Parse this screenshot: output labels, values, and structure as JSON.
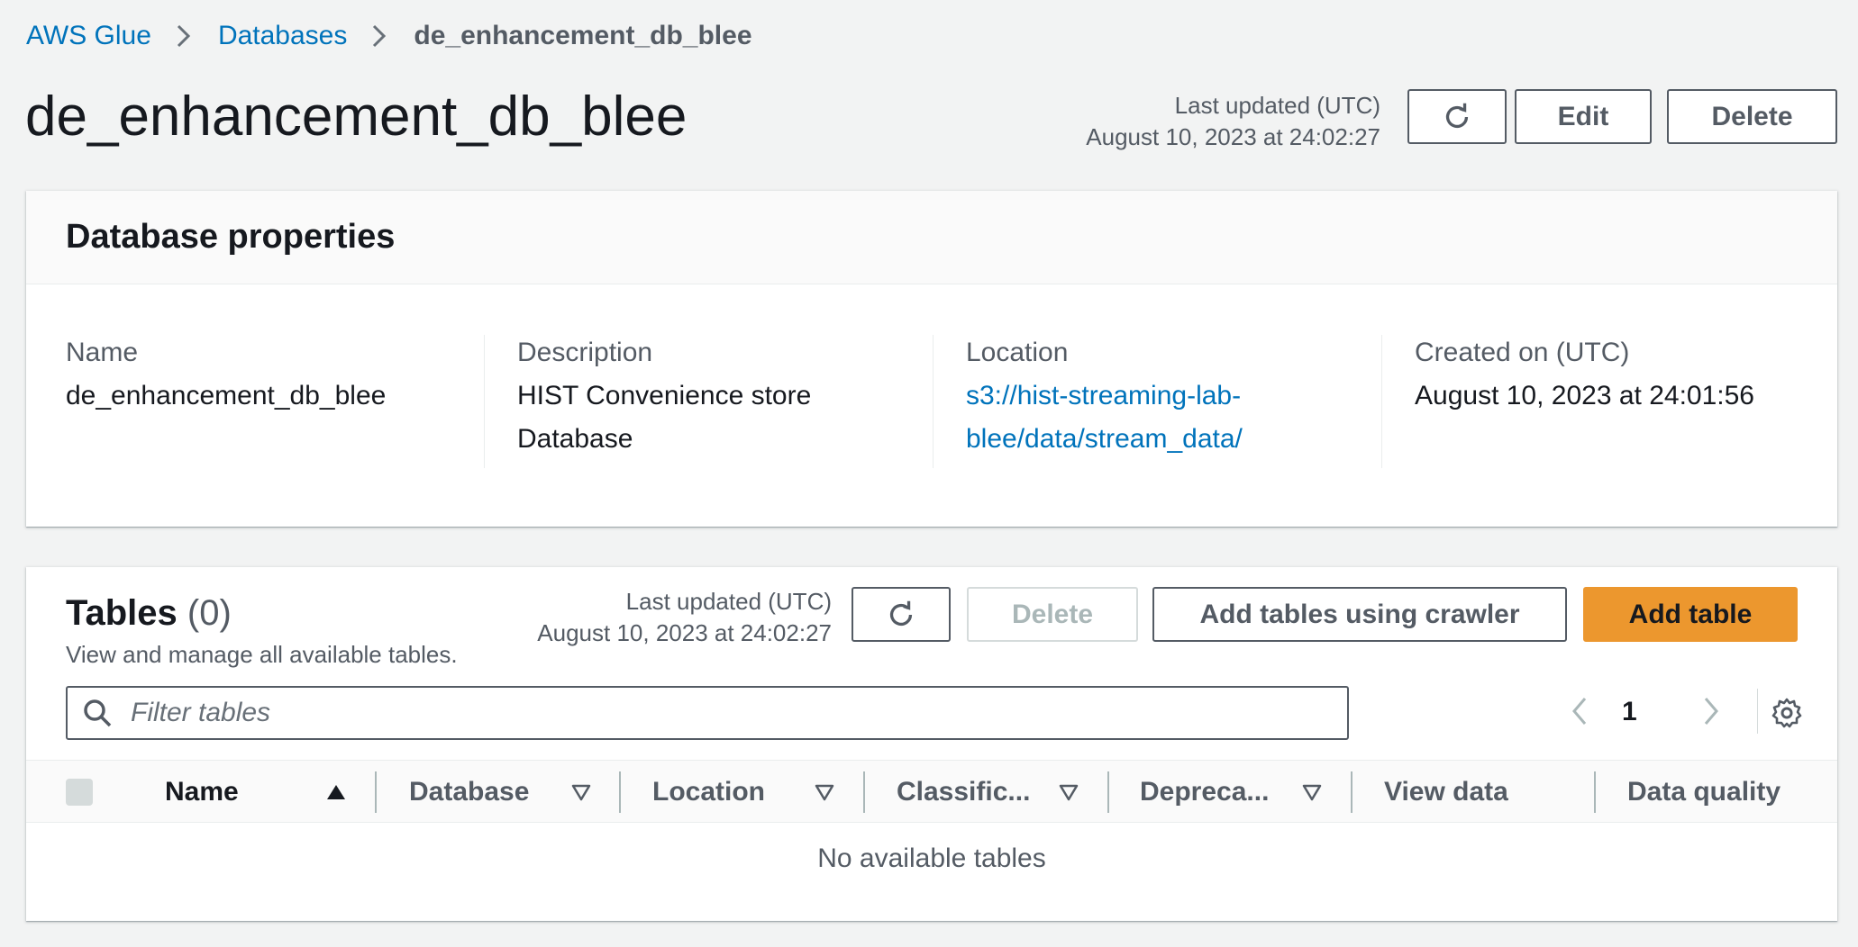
{
  "breadcrumb": {
    "items": [
      {
        "label": "AWS Glue"
      },
      {
        "label": "Databases"
      },
      {
        "label": "de_enhancement_db_blee"
      }
    ]
  },
  "header": {
    "title": "de_enhancement_db_blee",
    "last_updated_label": "Last updated (UTC)",
    "last_updated_value": "August 10, 2023 at 24:02:27",
    "edit_label": "Edit",
    "delete_label": "Delete"
  },
  "properties": {
    "heading": "Database properties",
    "name": {
      "label": "Name",
      "value": "de_enhancement_db_blee"
    },
    "description": {
      "label": "Description",
      "line1": "HIST Convenience store",
      "line2": "Database"
    },
    "location": {
      "label": "Location",
      "line1": "s3://hist-streaming-lab-",
      "line2": "blee/data/stream_data/"
    },
    "created": {
      "label": "Created on (UTC)",
      "value": "August 10, 2023 at 24:01:56"
    }
  },
  "tables": {
    "title": "Tables",
    "count": "(0)",
    "description": "View and manage all available tables.",
    "last_updated_label": "Last updated (UTC)",
    "last_updated_value": "August 10, 2023 at 24:02:27",
    "delete_label": "Delete",
    "add_crawler_label": "Add tables using crawler",
    "add_table_label": "Add table",
    "filter_placeholder": "Filter tables",
    "page": "1",
    "columns": [
      "Name",
      "Database",
      "Location",
      "Classific...",
      "Depreca...",
      "View data",
      "Data quality"
    ],
    "empty_message": "No available tables"
  },
  "colors": {
    "link": "#0073bb",
    "primary": "#ec972e",
    "background": "#f2f3f3"
  }
}
